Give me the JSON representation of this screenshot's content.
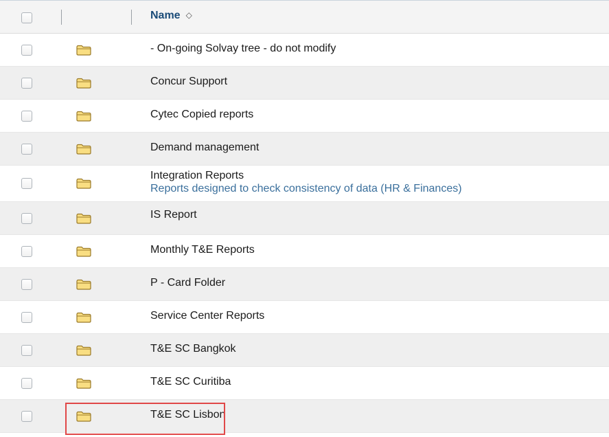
{
  "header": {
    "name_label": "Name",
    "sort_icon": "sort-icon"
  },
  "folder_icon": "folder-icon",
  "colors": {
    "folder_fill": "#f9de82",
    "folder_stroke": "#9a7a2a",
    "header_text": "#1a4b78",
    "description_text": "#3a6f9c",
    "highlight": "#e04848"
  },
  "rows": [
    {
      "name": "- On-going Solvay tree - do not modify",
      "description": ""
    },
    {
      "name": "Concur Support",
      "description": ""
    },
    {
      "name": "Cytec Copied reports",
      "description": ""
    },
    {
      "name": "Demand management",
      "description": ""
    },
    {
      "name": "Integration Reports",
      "description": "Reports designed to check consistency of data (HR & Finances)"
    },
    {
      "name": "IS Report",
      "description": ""
    },
    {
      "name": "Monthly T&E Reports",
      "description": ""
    },
    {
      "name": "P - Card Folder",
      "description": ""
    },
    {
      "name": "Service Center Reports",
      "description": ""
    },
    {
      "name": "T&E SC Bangkok",
      "description": ""
    },
    {
      "name": "T&E SC Curitiba",
      "description": ""
    },
    {
      "name": "T&E SC Lisbon",
      "description": ""
    }
  ]
}
